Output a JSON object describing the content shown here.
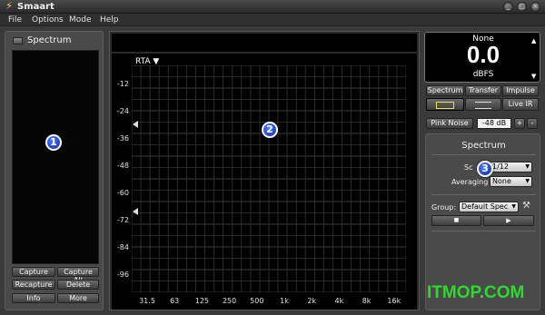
{
  "window": {
    "title": "Smaart",
    "app_icon": "lightning-icon",
    "controls": [
      "_",
      "□",
      "×"
    ]
  },
  "menu": [
    "File",
    "Options",
    "Mode",
    "Help"
  ],
  "left_panel": {
    "title": "Spectrum",
    "buttons": [
      "Capture",
      "Capture All",
      "Recapture",
      "Delete",
      "Info",
      "More"
    ]
  },
  "badges": [
    "1",
    "2",
    "3"
  ],
  "plot": {
    "rta_label": "RTA ▼",
    "y_ticks": [
      "-12",
      "-24",
      "-36",
      "-48",
      "-60",
      "-72",
      "-84",
      "-96"
    ],
    "x_ticks": [
      "31.5",
      "63",
      "125",
      "250",
      "500",
      "1k",
      "2k",
      "4k",
      "8k",
      "16k"
    ],
    "grid": true
  },
  "meter": {
    "source": "None",
    "value": "0.0",
    "unit": "dBFS"
  },
  "mode_tabs": [
    "Spectrum",
    "Transfer",
    "Impulse"
  ],
  "view_tabs": {
    "live_ir": "Live IR"
  },
  "pink_noise": {
    "label": "Pink Noise",
    "level": "-48 dB",
    "plus": "+",
    "minus": "-"
  },
  "spectrum_settings": {
    "title": "Spectrum",
    "scale_label": "Sc",
    "scale_value": "1/12",
    "averaging_label": "Averaging",
    "averaging_value": "None",
    "group_label": "Group:",
    "group_value": "Default Spec"
  },
  "transport": {
    "stop": "■",
    "play": "▶"
  },
  "watermark": "ITMOP.COM"
}
